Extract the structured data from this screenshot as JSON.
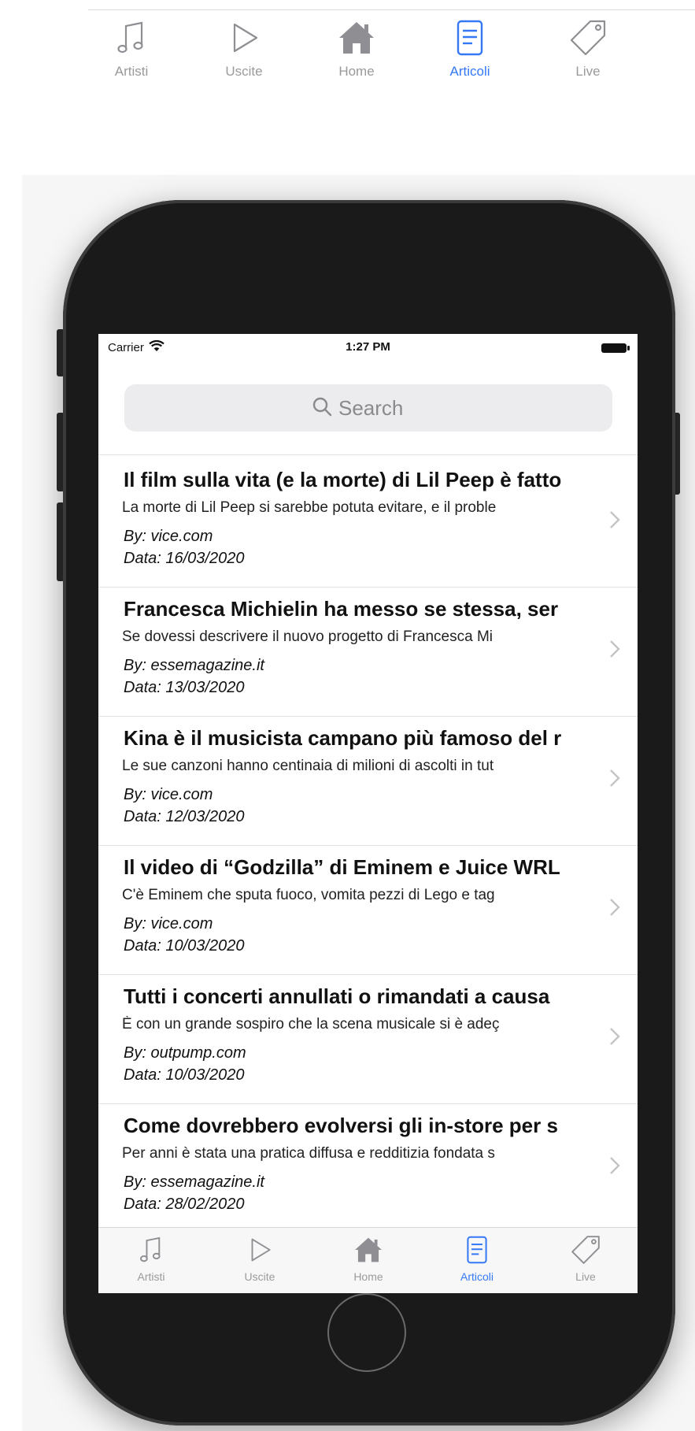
{
  "tabs": [
    {
      "label": "Artisti",
      "icon": "music-note-icon",
      "active": false
    },
    {
      "label": "Uscite",
      "icon": "play-icon",
      "active": false
    },
    {
      "label": "Home",
      "icon": "house-icon",
      "active": false
    },
    {
      "label": "Articoli",
      "icon": "document-icon",
      "active": true
    },
    {
      "label": "Live",
      "icon": "tag-icon",
      "active": false
    }
  ],
  "status_bar": {
    "carrier": "Carrier",
    "time": "1:27 PM"
  },
  "search": {
    "placeholder": "Search"
  },
  "articles": [
    {
      "title": "Il film sulla vita (e la morte) di Lil Peep è fatto",
      "snippet": "La morte di Lil Peep si sarebbe potuta evitare, e il proble",
      "source": "By: vice.com",
      "date": "Data: 16/03/2020"
    },
    {
      "title": "Francesca Michielin ha messo se stessa, ser",
      "snippet": "Se dovessi descrivere il nuovo progetto di Francesca Mi",
      "source": "By: essemagazine.it",
      "date": "Data: 13/03/2020"
    },
    {
      "title": "Kina è il musicista campano più famoso del r",
      "snippet": "Le sue canzoni hanno centinaia di milioni di ascolti in tut",
      "source": "By: vice.com",
      "date": "Data: 12/03/2020"
    },
    {
      "title": "Il video di “Godzilla” di Eminem e Juice WRL",
      "snippet": "C'è Eminem che sputa fuoco, vomita pezzi di Lego e tag",
      "source": "By: vice.com",
      "date": "Data: 10/03/2020"
    },
    {
      "title": "Tutti i concerti annullati o rimandati a causa",
      "snippet": "È con un grande sospiro che la scena musicale si è adeç",
      "source": "By: outpump.com",
      "date": "Data: 10/03/2020"
    },
    {
      "title": "Come dovrebbero evolversi gli in-store per s",
      "snippet": "Per anni è stata una pratica diffusa e redditizia fondata s",
      "source": "By: essemagazine.it",
      "date": "Data: 28/02/2020"
    }
  ],
  "colors": {
    "accent": "#3478f6",
    "inactive": "#9a9a9a",
    "device": "#1a1a1a"
  }
}
